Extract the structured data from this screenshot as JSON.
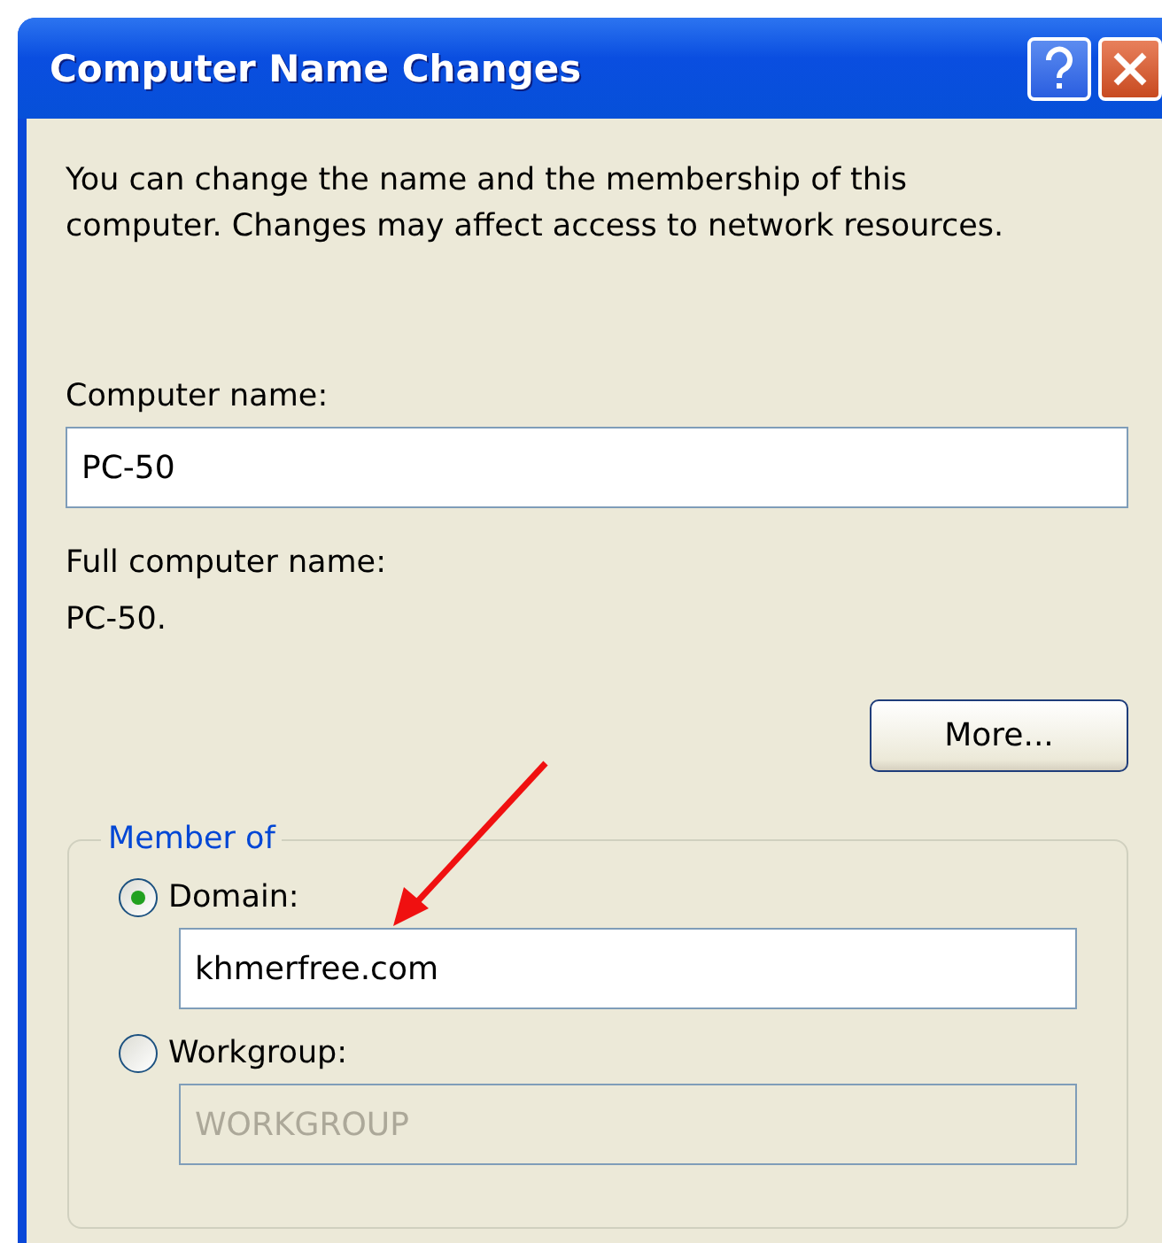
{
  "window": {
    "title": "Computer Name Changes"
  },
  "intro": "You can change the name and the membership of this computer. Changes may affect access to network resources.",
  "computer_name": {
    "label": "Computer name:",
    "value": "PC-50"
  },
  "full_name": {
    "label": "Full computer name:",
    "value": "PC-50."
  },
  "more_button": {
    "label": "More..."
  },
  "member_of": {
    "legend": "Member of",
    "options": [
      {
        "label": "Domain:",
        "selected": true,
        "value": "khmerfree.com"
      },
      {
        "label": "Workgroup:",
        "selected": false,
        "value": "WORKGROUP"
      }
    ]
  }
}
